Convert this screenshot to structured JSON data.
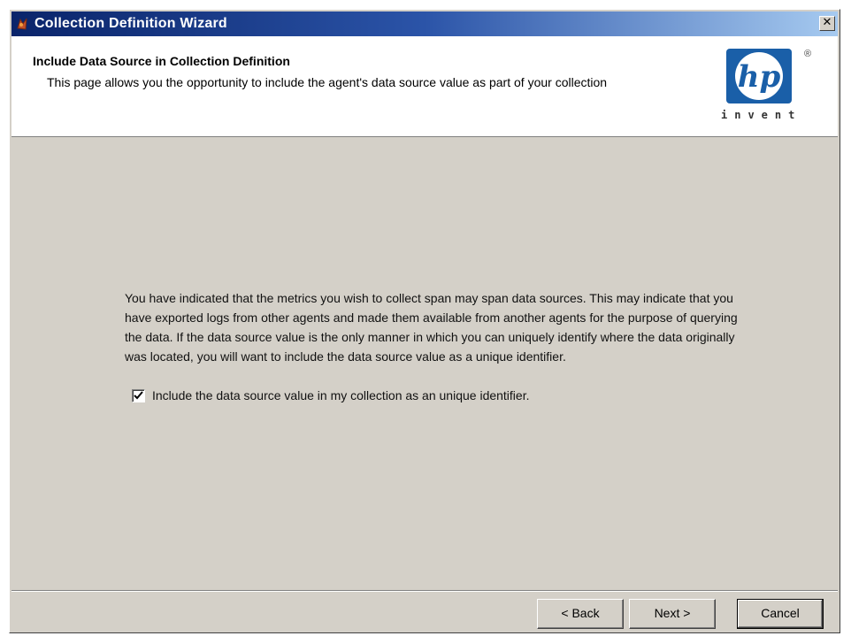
{
  "window": {
    "title": "Collection Definition Wizard",
    "close_glyph": "✕"
  },
  "header": {
    "title": "Include Data Source in Collection Definition",
    "description": "This page allows you the opportunity to include the agent's data source value as part of your collection",
    "logo_mark": "hp",
    "logo_tagline": "invent",
    "logo_registered": "®"
  },
  "content": {
    "paragraph": "You have indicated that the metrics you wish to collect span may span data sources. This may indicate that you have exported logs from other agents and made them available from another agents for the purpose of querying the data. If the data source value is the only manner in which you can uniquely identify where the data originally was located, you will want to include the data source value as a unique identifier.",
    "checkbox_label": "Include the data source value in my collection as an unique identifier.",
    "checkbox_checked": true
  },
  "buttons": {
    "back": "< Back",
    "next": "Next >",
    "cancel": "Cancel"
  },
  "colors": {
    "titlebar_start": "#0a246a",
    "titlebar_end": "#a6caf0",
    "logo_blue": "#1a5fa8",
    "dialog_face": "#d4d0c8"
  }
}
